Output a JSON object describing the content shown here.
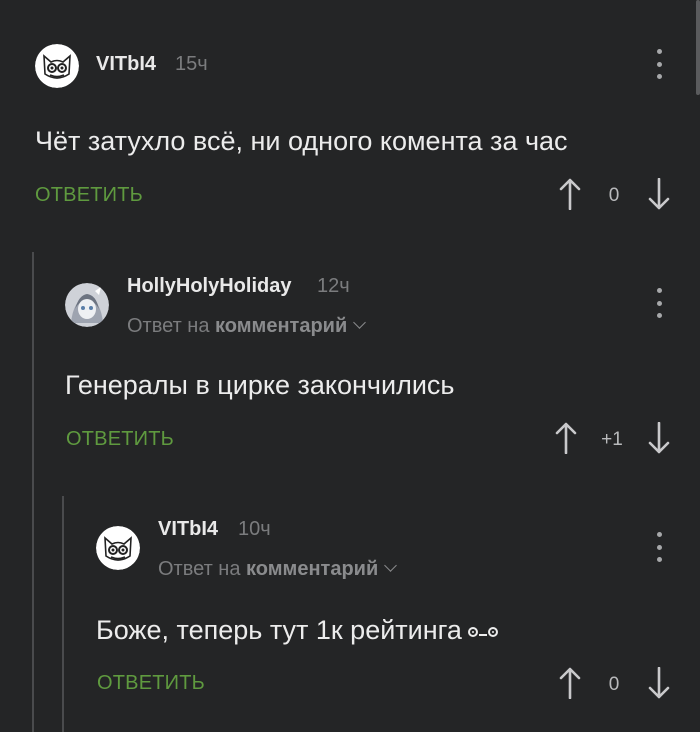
{
  "comments": [
    {
      "author": "VITbI4",
      "time": "15ч",
      "text": "Чёт затухло всё, ни одного комента за час",
      "reply_label": "ОТВЕТИТЬ",
      "score": "0",
      "avatar_icon": "cat-avatar-icon"
    },
    {
      "author": "HollyHolyHoliday",
      "time": "12ч",
      "reply_prefix": "Ответ на",
      "reply_target": "комментарий",
      "text": "Генералы в цирке закончились",
      "reply_label": "ОТВЕТИТЬ",
      "score": "+1",
      "avatar_icon": "anime-avatar-icon"
    },
    {
      "author": "VITbI4",
      "time": "10ч",
      "reply_prefix": "Ответ на",
      "reply_target": "комментарий",
      "text": "Боже, теперь тут 1к рейтинга",
      "reply_label": "ОТВЕТИТЬ",
      "score": "0",
      "avatar_icon": "cat-avatar-icon"
    }
  ],
  "colors": {
    "background": "#242526",
    "reply_green": "#5f9a3f",
    "meta_grey": "#7b7c7e",
    "text": "#ececec"
  }
}
